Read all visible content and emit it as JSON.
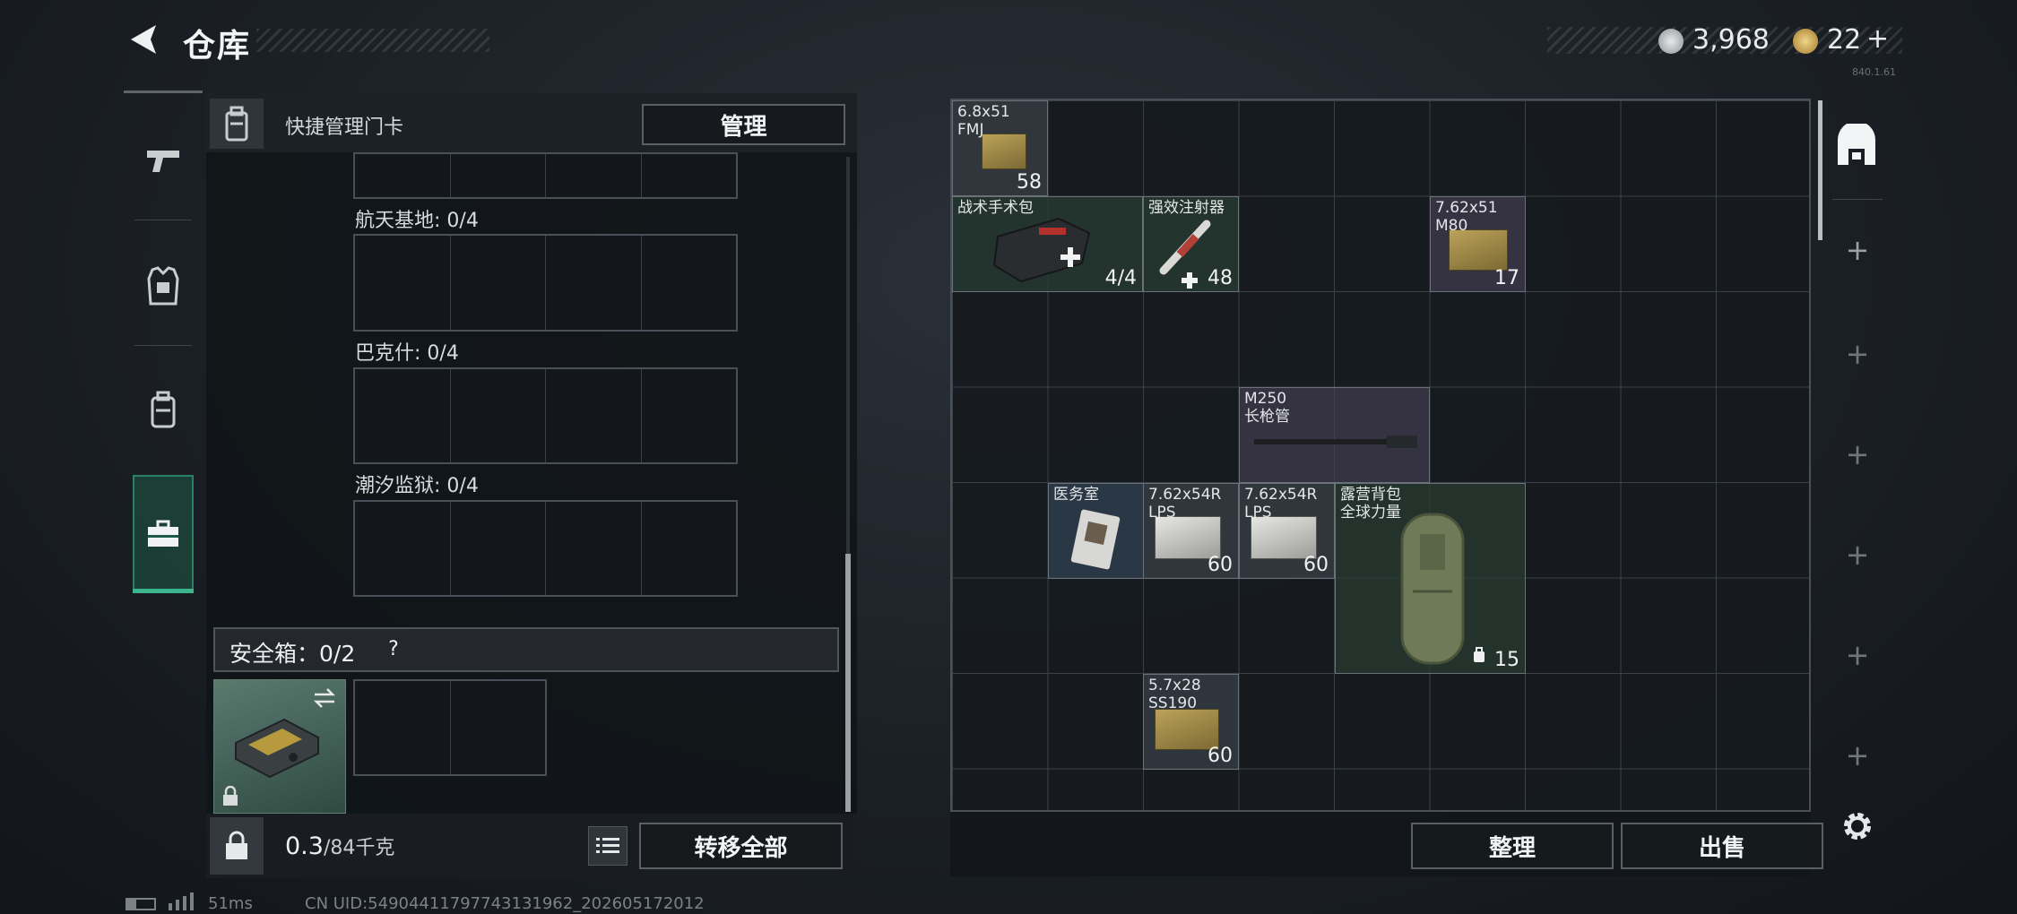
{
  "header": {
    "title": "仓库",
    "currency1": "3,968",
    "currency2": "22",
    "currency2_plus": "+",
    "version": "840.1.61"
  },
  "left_panel": {
    "keycard_label": "快捷管理门卡",
    "manage_button": "管理",
    "regions": [
      {
        "label": "航天基地: 0/4"
      },
      {
        "label": "巴克什: 0/4"
      },
      {
        "label": "潮汐监狱: 0/4"
      }
    ],
    "safe_box_label": "安全箱：0/2",
    "help_icon": "?",
    "weight_value": "0.3",
    "weight_max": "/84千克",
    "transfer_all_button": "转移全部"
  },
  "stash": {
    "items": [
      {
        "name": "6.8x51\nFMJ",
        "count": "58",
        "icon": "ammo-box-icon"
      },
      {
        "name": "战术手术包",
        "count": "4/4",
        "icon": "first-aid-kit-icon"
      },
      {
        "name": "强效注射器",
        "count": "48",
        "icon": "syringe-icon"
      },
      {
        "name": "7.62x51\nM80",
        "count": "17",
        "icon": "ammo-box-icon"
      },
      {
        "name": "M250\n长枪管",
        "count": "",
        "icon": "barrel-icon"
      },
      {
        "name": "医务室",
        "count": "",
        "icon": "keycard-icon"
      },
      {
        "name": "7.62x54R\nLPS",
        "count": "60",
        "icon": "ammo-box-icon"
      },
      {
        "name": "7.62x54R\nLPS",
        "count": "60",
        "icon": "ammo-box-icon"
      },
      {
        "name": "露营背包\n全球力量",
        "count": "15",
        "icon": "backpack-icon"
      },
      {
        "name": "5.7x28\nSS190",
        "count": "60",
        "icon": "ammo-box-icon"
      }
    ],
    "sort_button": "整理",
    "sell_button": "出售"
  },
  "footer": {
    "ping": "51ms",
    "uid": "CN UID:54904411797743131962_202605172012"
  },
  "colors": {
    "accent_green": "#3cb48c",
    "coin_silver": "#b8bcc0",
    "coin_gold": "#c9a24a"
  }
}
